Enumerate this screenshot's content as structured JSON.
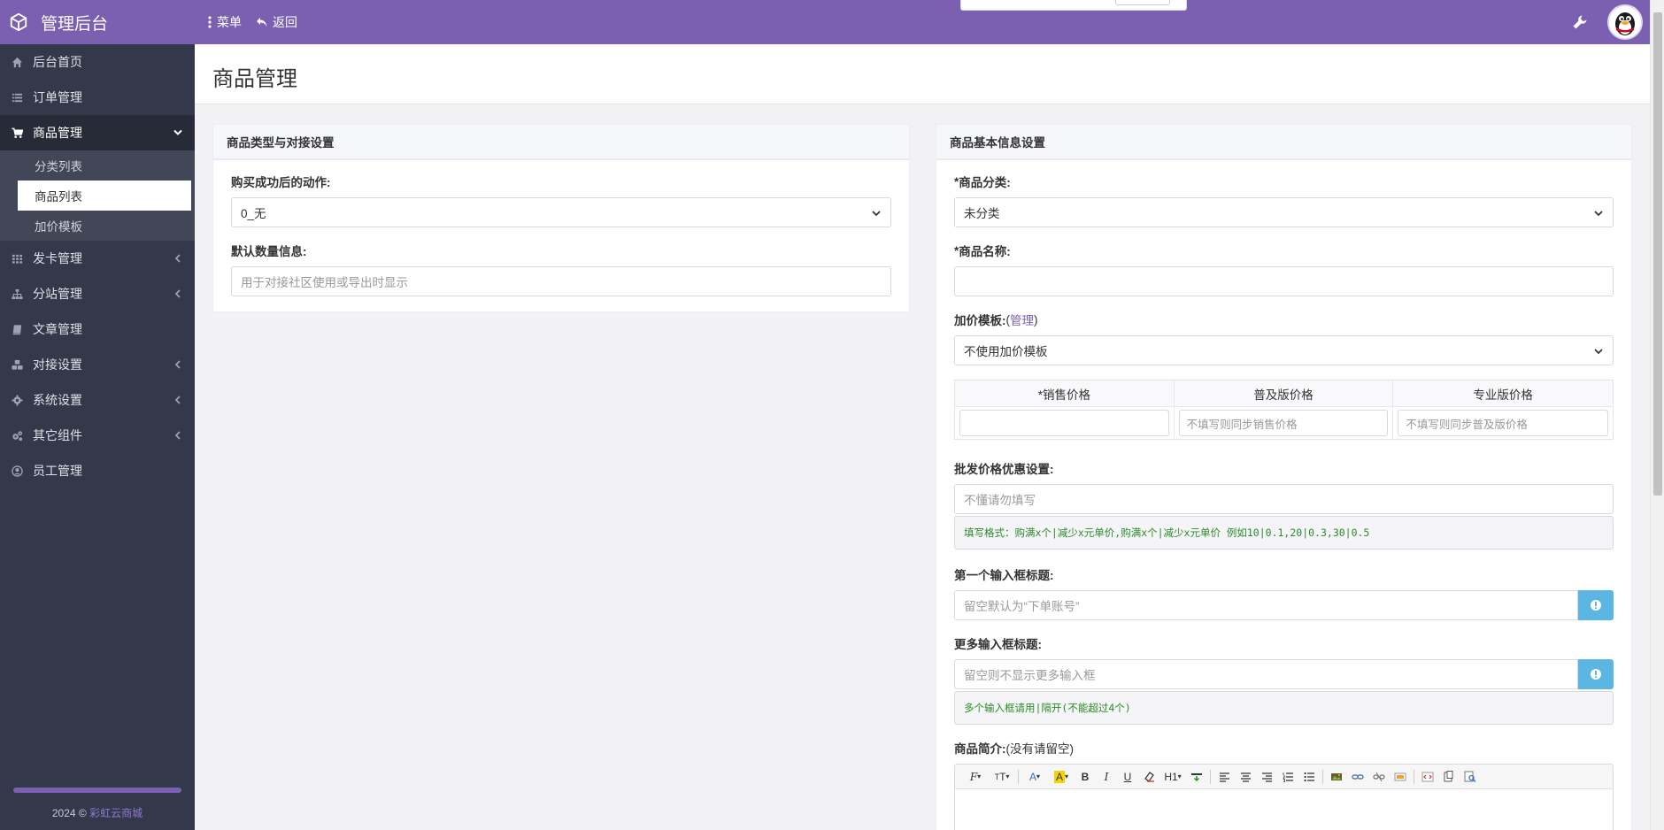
{
  "app": {
    "title": "管理后台",
    "menu_label": "菜单",
    "back_label": "返回"
  },
  "colors": {
    "topbar": "#7b5fb0",
    "sidebar": "#33384a",
    "accent": "#7b5fb0",
    "info_button": "#5bb6e4",
    "hint_text": "#2a8a2a"
  },
  "sidebar": {
    "items": [
      {
        "label": "后台首页",
        "icon": "home-icon"
      },
      {
        "label": "订单管理",
        "icon": "list-icon"
      },
      {
        "label": "商品管理",
        "icon": "cart-icon"
      },
      {
        "label": "发卡管理",
        "icon": "grid-icon"
      },
      {
        "label": "分站管理",
        "icon": "sitemap-icon"
      },
      {
        "label": "文章管理",
        "icon": "book-icon"
      },
      {
        "label": "对接设置",
        "icon": "cubes-icon"
      },
      {
        "label": "系统设置",
        "icon": "gear-icon"
      },
      {
        "label": "其它组件",
        "icon": "cogs-icon"
      },
      {
        "label": "员工管理",
        "icon": "user-circle-icon"
      }
    ],
    "sub_items": [
      "分类列表",
      "商品列表",
      "加价模板"
    ],
    "footer_year": "2024 ©",
    "footer_link": "彩虹云商城"
  },
  "page": {
    "title": "商品管理"
  },
  "left_panel": {
    "title": "商品类型与对接设置",
    "action_label": "购买成功后的动作:",
    "action_value": "0_无",
    "qty_label": "默认数量信息:",
    "qty_placeholder": "用于对接社区使用或导出时显示"
  },
  "right_panel": {
    "title": "商品基本信息设置",
    "category_label": "商品分类:",
    "category_value": "未分类",
    "name_label": "商品名称:",
    "name_value": "",
    "markup_label": "加价模板:",
    "markup_link_open": " (",
    "markup_link": "管理",
    "markup_link_close": ")",
    "markup_value": "不使用加价模板",
    "price_headers": [
      "*销售价格",
      "普及版价格",
      "专业版价格"
    ],
    "price_placeholders": [
      "",
      "不填写则同步销售价格",
      "不填写则同步普及版价格"
    ],
    "wholesale_label": "批发价格优惠设置:",
    "wholesale_placeholder": "不懂请勿填写",
    "wholesale_hint": "填写格式：购满x个|减少x元单价,购满x个|减少x元单价  例如10|0.1,20|0.3,30|0.5",
    "first_input_label": "第一个输入框标题:",
    "first_input_placeholder": "留空默认为“下单账号”",
    "more_input_label": "更多输入框标题:",
    "more_input_placeholder": "留空则不显示更多输入框",
    "more_input_hint": "多个输入框请用|隔开(不能超过4个)",
    "desc_label": "商品简介:",
    "desc_note": "(没有请留空)",
    "toolbar": {
      "heading": "H1"
    }
  }
}
